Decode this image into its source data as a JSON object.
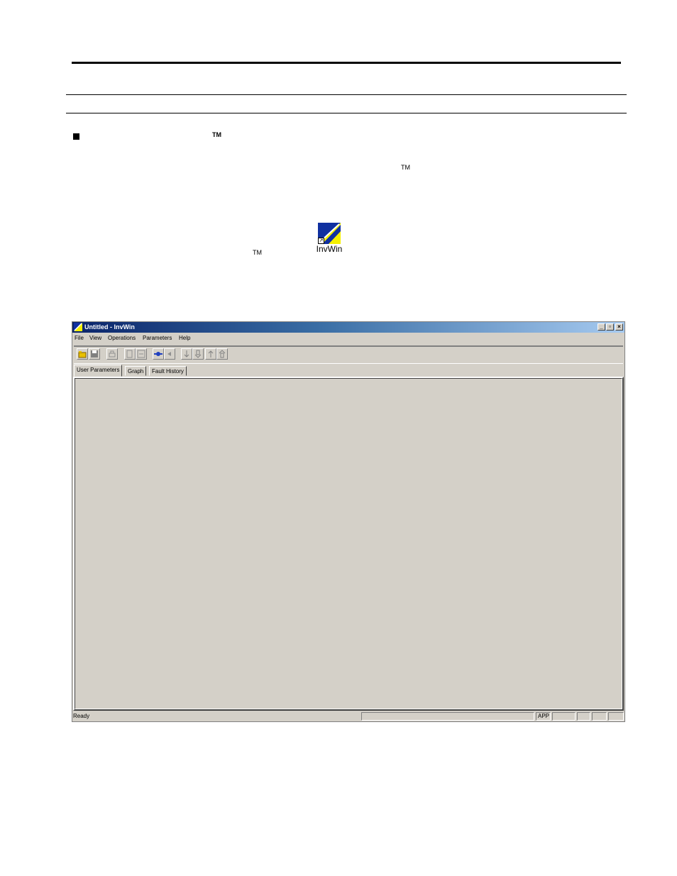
{
  "page": {
    "tm_heading": "TM",
    "tm_para1": "TM",
    "tm_para2": "TM",
    "desktop_icon": {
      "label": "InvWin",
      "shortcut_glyph": "↗"
    }
  },
  "window": {
    "title": "Untitled - InvWin",
    "controls": {
      "minimize": "_",
      "restore": "▫",
      "close": "×"
    },
    "menu": [
      "File",
      "View",
      "Operations",
      "Parameters",
      "Help"
    ],
    "toolbar_icons": [
      "open-icon",
      "save-icon",
      "print-icon",
      "copy-icon",
      "compare-icon",
      "connect-icon",
      "disconnect-icon",
      "download-icon",
      "download-all-icon",
      "upload-icon",
      "upload-all-icon"
    ],
    "tabs": [
      "User Parameters",
      "Graph",
      "Fault History"
    ],
    "status": {
      "text": "Ready",
      "indicator": "APP"
    }
  }
}
